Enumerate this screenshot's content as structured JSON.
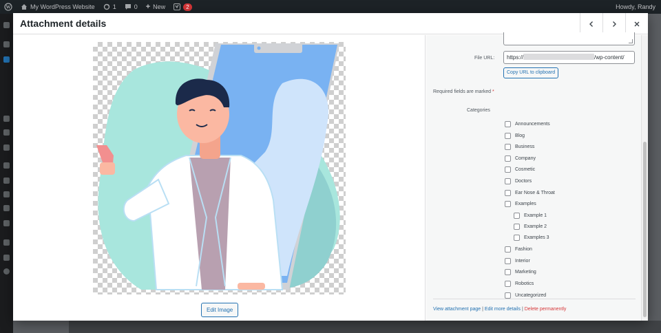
{
  "adminbar": {
    "site_name": "My WordPress Website",
    "updates_count": "1",
    "comments_count": "0",
    "new_label": "New",
    "yoast_count": "2",
    "howdy": "Howdy, Randy"
  },
  "modal": {
    "title": "Attachment details",
    "prev_icon": "chevron-left-icon",
    "next_icon": "chevron-right-icon",
    "close_icon": "close-icon"
  },
  "preview": {
    "edit_image_label": "Edit Image"
  },
  "details": {
    "file_url_label": "File URL:",
    "file_url_start": "https://",
    "file_url_end": "/wp-content/",
    "copy_url_label": "Copy URL to clipboard",
    "required_note": "Required fields are marked",
    "required_star": "*",
    "categories_label": "Categories",
    "categories": [
      {
        "label": "Announcements",
        "checked": false
      },
      {
        "label": "Blog",
        "checked": false
      },
      {
        "label": "Business",
        "checked": false
      },
      {
        "label": "Company",
        "checked": false
      },
      {
        "label": "Cosmetic",
        "checked": false
      },
      {
        "label": "Doctors",
        "checked": false
      },
      {
        "label": "Ear Nose & Throat",
        "checked": false
      },
      {
        "label": "Examples",
        "checked": false
      },
      {
        "label": "Example 1",
        "checked": false
      },
      {
        "label": "Example 2",
        "checked": false
      },
      {
        "label": "Examples 3",
        "checked": false
      },
      {
        "label": "Fashion",
        "checked": false
      },
      {
        "label": "Interior",
        "checked": false
      },
      {
        "label": "Marketing",
        "checked": false
      },
      {
        "label": "Robotics",
        "checked": false
      },
      {
        "label": "Uncategorized",
        "checked": false
      }
    ],
    "footer": {
      "view_page": "View attachment page",
      "sep1": " | ",
      "edit_more": "Edit more details",
      "sep2": " | ",
      "delete": "Delete permanently"
    }
  },
  "colors": {
    "accent": "#2271b1",
    "danger": "#d63638",
    "admin_bar": "#1d2327"
  }
}
